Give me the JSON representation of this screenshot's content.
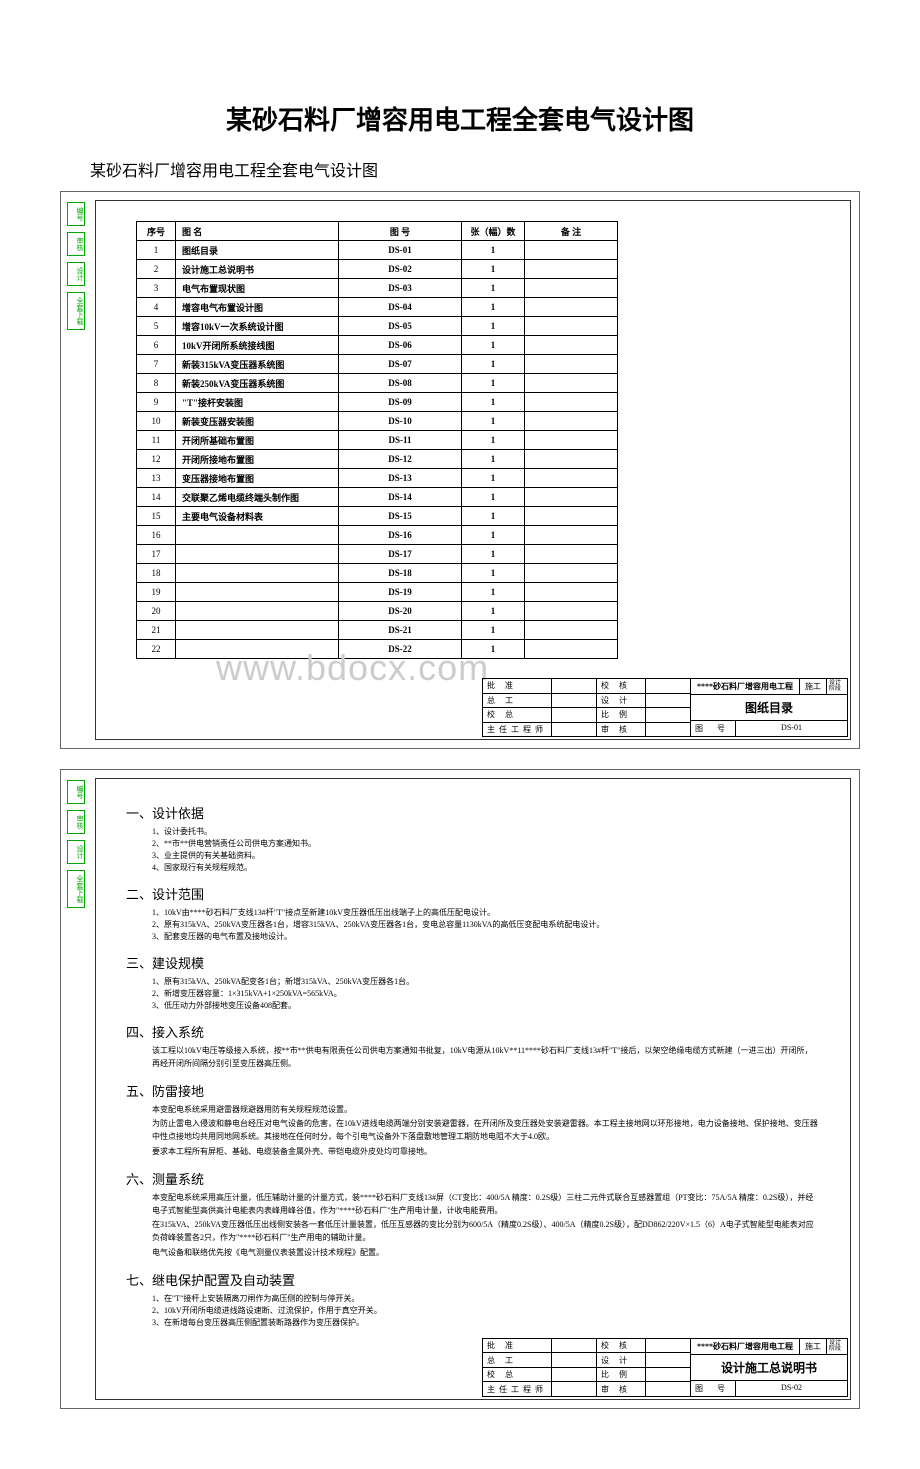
{
  "mainTitle": "某砂石料厂增容用电工程全套电气设计图",
  "subTitle": "某砂石料厂增容用电工程全套电气设计图",
  "watermark": "www.bdocx.com",
  "sideTabs": [
    "编号",
    "审核",
    "设计",
    "全套下载"
  ],
  "toc": {
    "headers": {
      "seq": "序号",
      "name": "图        名",
      "no": "图    号",
      "cnt": "张（幅）数",
      "rem": "备    注"
    },
    "rows": [
      {
        "seq": "1",
        "name": "图纸目录",
        "no": "DS-01",
        "cnt": "1"
      },
      {
        "seq": "2",
        "name": "设计施工总说明书",
        "no": "DS-02",
        "cnt": "1"
      },
      {
        "seq": "3",
        "name": "电气布置现状图",
        "no": "DS-03",
        "cnt": "1"
      },
      {
        "seq": "4",
        "name": "增容电气布置设计图",
        "no": "DS-04",
        "cnt": "1"
      },
      {
        "seq": "5",
        "name": "增容10kV一次系统设计图",
        "no": "DS-05",
        "cnt": "1"
      },
      {
        "seq": "6",
        "name": "10kV开闭所系统接线图",
        "no": "DS-06",
        "cnt": "1"
      },
      {
        "seq": "7",
        "name": "新装315kVA变压器系统图",
        "no": "DS-07",
        "cnt": "1"
      },
      {
        "seq": "8",
        "name": "新装250kVA变压器系统图",
        "no": "DS-08",
        "cnt": "1"
      },
      {
        "seq": "9",
        "name": "\"T\"接杆安装图",
        "no": "DS-09",
        "cnt": "1"
      },
      {
        "seq": "10",
        "name": "新装变压器安装图",
        "no": "DS-10",
        "cnt": "1"
      },
      {
        "seq": "11",
        "name": "开闭所基础布置图",
        "no": "DS-11",
        "cnt": "1"
      },
      {
        "seq": "12",
        "name": "开闭所接地布置图",
        "no": "DS-12",
        "cnt": "1"
      },
      {
        "seq": "13",
        "name": "变压器接地布置图",
        "no": "DS-13",
        "cnt": "1"
      },
      {
        "seq": "14",
        "name": "交联聚乙烯电缆终端头制作图",
        "no": "DS-14",
        "cnt": "1"
      },
      {
        "seq": "15",
        "name": "主要电气设备材料表",
        "no": "DS-15",
        "cnt": "1"
      },
      {
        "seq": "16",
        "name": "",
        "no": "DS-16",
        "cnt": "1"
      },
      {
        "seq": "17",
        "name": "",
        "no": "DS-17",
        "cnt": "1"
      },
      {
        "seq": "18",
        "name": "",
        "no": "DS-18",
        "cnt": "1"
      },
      {
        "seq": "19",
        "name": "",
        "no": "DS-19",
        "cnt": "1"
      },
      {
        "seq": "20",
        "name": "",
        "no": "DS-20",
        "cnt": "1"
      },
      {
        "seq": "21",
        "name": "",
        "no": "DS-21",
        "cnt": "1"
      },
      {
        "seq": "22",
        "name": "",
        "no": "DS-22",
        "cnt": "1"
      }
    ]
  },
  "titleBlock": {
    "signRows": [
      [
        "批  准",
        "",
        "校  核",
        ""
      ],
      [
        "总  工",
        "",
        "设  计",
        ""
      ],
      [
        "校  总",
        "",
        "比  例",
        ""
      ],
      [
        "主任工程师",
        "",
        "审  核",
        ""
      ]
    ],
    "projectName": "****砂石料厂增容用电工程",
    "stageLabel": "施工",
    "stageLabel2": "设计\n阶段",
    "sheet1Title": "图纸目录",
    "sheet1No": "DS-01",
    "sheet2Title": "设计施工总说明书",
    "sheet2No": "DS-02",
    "noLabel": "图   号"
  },
  "spec": {
    "s1": {
      "title": "一、设计依据",
      "items": [
        "1、设计委托书。",
        "2、**市**供电营销责任公司供电方案通知书。",
        "3、业主提供的有关基础资料。",
        "4、国家现行有关规程规范。"
      ]
    },
    "s2": {
      "title": "二、设计范围",
      "items": [
        "1、10kV由****砂石料厂支线13#杆\"T\"接点至新建10kV变压器低压出线端子上的高低压配电设计。",
        "2、原有315kVA、250kVA变压器各1台，增容315kVA、250kVA变压器各1台，变电总容量1130kVA的高低压变配电系统配电设计。",
        "3、配套变压器的电气布置及接地设计。"
      ]
    },
    "s3": {
      "title": "三、建设规模",
      "items": [
        "1、原有315kVA、250kVA配变各1台；新增315kVA、250kVA变压器各1台。",
        "2、新增变压器容量：1×315kVA+1×250kVA=565kVA。",
        "3、低压动力外部接地变压设备408配套。"
      ]
    },
    "s4": {
      "title": "四、接入系统",
      "para": "该工程以10kV电压等级接入系统，按**市**供电有限责任公司供电方案通知书批复，10kV电源从10kV**11****砂石料厂支线13#杆\"T\"接后，以架空绝缘电缆方式新建（一进三出）开闭所，再经开闭所间隔分别引至变压器高压侧。"
    },
    "s5": {
      "title": "五、防雷接地",
      "paras": [
        "本变配电系统采用避雷器规避器用防有关规程规范设置。",
        "为防止雷电入侵波和静电台经压对电气设备的危害，在10kV进线电缆两端分别安装避雷器，在开闭所及变压器处安装避雷器。本工程主接地网以环形接地，电力设备接地、保护接地、变压器中性点接地均共用同地网系统。其接地在任何时分，每个引电气设备外下落盘敷地管理工期防地电阻不大于4.0欧。",
        "要求本工程所有屏柜、基础、电缆装备金属外壳、带铠电缆外皮处均可靠接地。"
      ]
    },
    "s6": {
      "title": "六、测量系统",
      "paras": [
        "本变配电系统采用高压计量，低压辅助计量的计量方式，装****砂石料厂支线13#屏（CT变比：400/5A 精度：0.2S级）三柱二元件式联合互感器置组（PT变比：75A/5A 精度：0.2S级），并经电子式智能型高供高计电能表内表峰用峰谷值，作为\"****砂石料厂\"生产用电计量，计收电能费用。",
        "在315kVA、250kVA变压器低压出线侧安装各一套低压计量装置，低压互感器的变比分别为600/5A（精度0.2S级）、400/5A（精度0.2S级），配DD862/220V×1.5（6）A电子式智能型电能表对应负荷峰装置各2只，作为\"****砂石料厂\"生产用电的辅助计量。",
        "电气设备和联络优先按《电气测量仪表装置设计技术规程》配置。"
      ]
    },
    "s7": {
      "title": "七、继电保护配置及自动装置",
      "items": [
        "1、在\"T\"接杆上安装隔离刀闸作为高压侧的控制与停开关。",
        "2、10kV开闭所电缆进线路设速断、过流保护，作用于真空开关。",
        "3、在新增每台变压器高压侧配置装断路器作为变压器保护。"
      ]
    }
  }
}
